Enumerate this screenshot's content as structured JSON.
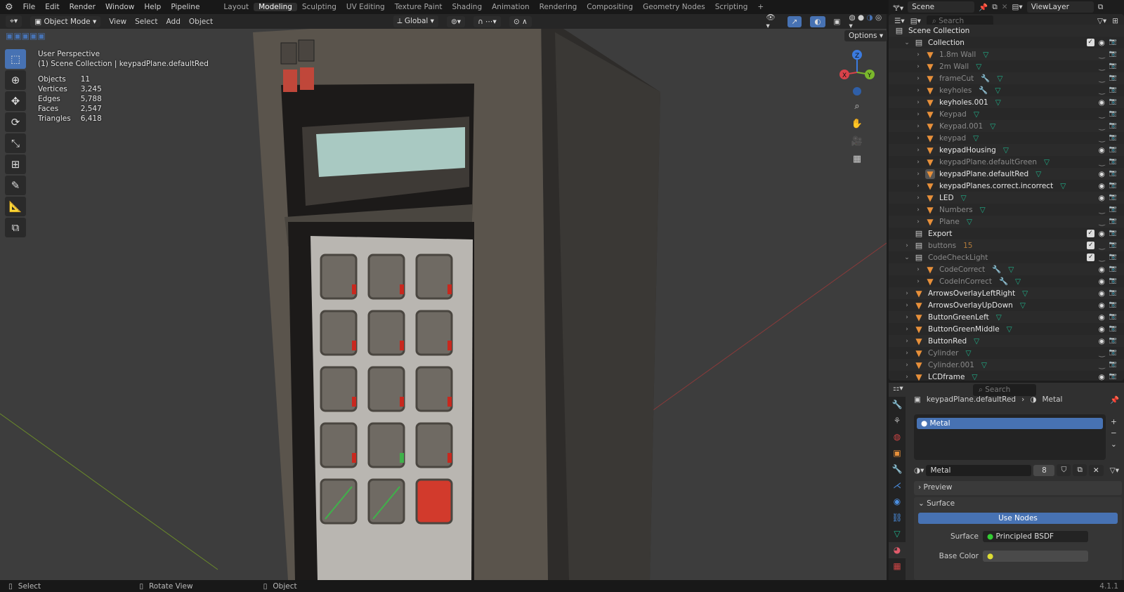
{
  "menu": {
    "items": [
      "File",
      "Edit",
      "Render",
      "Window",
      "Help",
      "Pipeline"
    ]
  },
  "workspaces": {
    "tabs": [
      "Layout",
      "Modeling",
      "Sculpting",
      "UV Editing",
      "Texture Paint",
      "Shading",
      "Animation",
      "Rendering",
      "Compositing",
      "Geometry Nodes",
      "Scripting"
    ],
    "active": "Modeling",
    "add": "+"
  },
  "viewport_header": {
    "mode": "Object Mode",
    "menus": [
      "View",
      "Select",
      "Add",
      "Object"
    ],
    "orientation": "Global",
    "options": "Options"
  },
  "overlay": {
    "view": "User Perspective",
    "context": "(1) Scene Collection | keypadPlane.defaultRed",
    "stats": [
      {
        "label": "Objects",
        "value": "11"
      },
      {
        "label": "Vertices",
        "value": "3,245"
      },
      {
        "label": "Edges",
        "value": "5,788"
      },
      {
        "label": "Faces",
        "value": "2,547"
      },
      {
        "label": "Triangles",
        "value": "6,418"
      }
    ]
  },
  "gizmo": {
    "x": "X",
    "y": "Y",
    "z": "Z"
  },
  "scene": {
    "scene_name": "Scene",
    "view_layer": "ViewLayer"
  },
  "outliner": {
    "search_placeholder": "Search",
    "items": [
      {
        "name": "Scene Collection",
        "depth": 0,
        "type": "collection",
        "dim": false
      },
      {
        "name": "Collection",
        "depth": 1,
        "type": "collection",
        "expanded": true,
        "checked": true,
        "visible": true
      },
      {
        "name": "1.8m Wall",
        "depth": 2,
        "type": "mesh",
        "dim": true,
        "visible": false
      },
      {
        "name": "2m Wall",
        "depth": 2,
        "type": "mesh",
        "dim": true,
        "visible": false
      },
      {
        "name": "frameCut",
        "depth": 2,
        "type": "mesh",
        "dim": true,
        "modifier": true,
        "visible": false
      },
      {
        "name": "keyholes",
        "depth": 2,
        "type": "mesh",
        "dim": true,
        "modifier": true,
        "visible": false
      },
      {
        "name": "keyholes.001",
        "depth": 2,
        "type": "mesh",
        "visible": true
      },
      {
        "name": "Keypad",
        "depth": 2,
        "type": "mesh",
        "dim": true,
        "visible": false
      },
      {
        "name": "Keypad.001",
        "depth": 2,
        "type": "mesh",
        "dim": true,
        "visible": false
      },
      {
        "name": "keypad",
        "depth": 2,
        "type": "mesh",
        "dim": true,
        "visible": false
      },
      {
        "name": "keypadHousing",
        "depth": 2,
        "type": "mesh",
        "visible": true
      },
      {
        "name": "keypadPlane.defaultGreen",
        "depth": 2,
        "type": "mesh",
        "dim": true,
        "visible": false
      },
      {
        "name": "keypadPlane.defaultRed",
        "depth": 2,
        "type": "mesh",
        "visible": true,
        "active": true
      },
      {
        "name": "keypadPlanes.correct.incorrect",
        "depth": 2,
        "type": "mesh",
        "visible": true
      },
      {
        "name": "LED",
        "depth": 2,
        "type": "mesh",
        "visible": true
      },
      {
        "name": "Numbers",
        "depth": 2,
        "type": "mesh",
        "dim": true,
        "visible": false
      },
      {
        "name": "Plane",
        "depth": 2,
        "type": "mesh",
        "dim": true,
        "visible": false
      },
      {
        "name": "Export",
        "depth": 1,
        "type": "collection",
        "checked": true,
        "visible": true,
        "nochev": true
      },
      {
        "name": "buttons",
        "depth": 1,
        "type": "collection",
        "dim": true,
        "checked": true,
        "visible": false,
        "count": "15"
      },
      {
        "name": "CodeCheckLight",
        "depth": 1,
        "type": "collection",
        "dim": true,
        "expanded": true,
        "checked": true,
        "visible": false
      },
      {
        "name": "CodeCorrect",
        "depth": 2,
        "type": "mesh",
        "dim": true,
        "modifier": true,
        "visible": true
      },
      {
        "name": "CodeInCorrect",
        "depth": 2,
        "type": "mesh",
        "dim": true,
        "modifier": true,
        "visible": true
      },
      {
        "name": "ArrowsOverlayLeftRight",
        "depth": 1,
        "type": "mesh",
        "visible": true
      },
      {
        "name": "ArrowsOverlayUpDown",
        "depth": 1,
        "type": "mesh",
        "visible": true
      },
      {
        "name": "ButtonGreenLeft",
        "depth": 1,
        "type": "mesh",
        "visible": true
      },
      {
        "name": "ButtonGreenMiddle",
        "depth": 1,
        "type": "mesh",
        "visible": true
      },
      {
        "name": "ButtonRed",
        "depth": 1,
        "type": "mesh",
        "visible": true
      },
      {
        "name": "Cylinder",
        "depth": 1,
        "type": "mesh",
        "dim": true,
        "visible": false
      },
      {
        "name": "Cylinder.001",
        "depth": 1,
        "type": "mesh",
        "dim": true,
        "visible": false
      },
      {
        "name": "LCDframe",
        "depth": 1,
        "type": "mesh",
        "visible": true
      }
    ]
  },
  "properties": {
    "search_placeholder": "Search",
    "breadcrumb_object": "keypadPlane.defaultRed",
    "breadcrumb_material": "Metal",
    "slot": "Metal",
    "material_name": "Metal",
    "users": "8",
    "preview_label": "Preview",
    "surface_panel": "Surface",
    "use_nodes": "Use Nodes",
    "surface_label": "Surface",
    "surface_value": "Principled BSDF",
    "base_color_label": "Base Color"
  },
  "statusbar": {
    "select": "Select",
    "rotate": "Rotate View",
    "object": "Object",
    "version": "4.1.1"
  },
  "colors": {
    "accent": "#4772b3",
    "mesh": "#e8903a",
    "data": "#1fb089",
    "red_button": "#d23a2c",
    "lcd": "#a9c9c2"
  }
}
